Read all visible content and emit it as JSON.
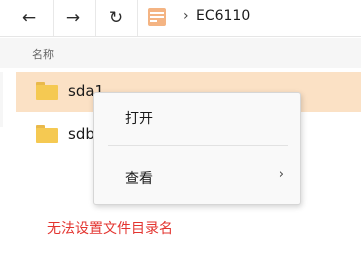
{
  "toolbar": {
    "back_icon": "←",
    "forward_icon": "→",
    "refresh_icon": "↻",
    "breadcrumb_separator": "›",
    "breadcrumb_current": "EC6110",
    "location_icon": "device-folder-icon"
  },
  "file_list": {
    "column_header": "名称",
    "items": [
      {
        "name": "sda1",
        "selected": true
      },
      {
        "name": "sdb1",
        "selected": false
      }
    ]
  },
  "context_menu": {
    "items": [
      {
        "label": "打开",
        "has_submenu": false
      },
      {
        "label": "查看",
        "has_submenu": true
      }
    ],
    "submenu_arrow": "›"
  },
  "caption": "无法设置文件目录名",
  "colors": {
    "selection": "#fbe1c5",
    "folder": "#f5c952",
    "caption": "#e3342f",
    "menu_bg": "#f9f9f9"
  }
}
